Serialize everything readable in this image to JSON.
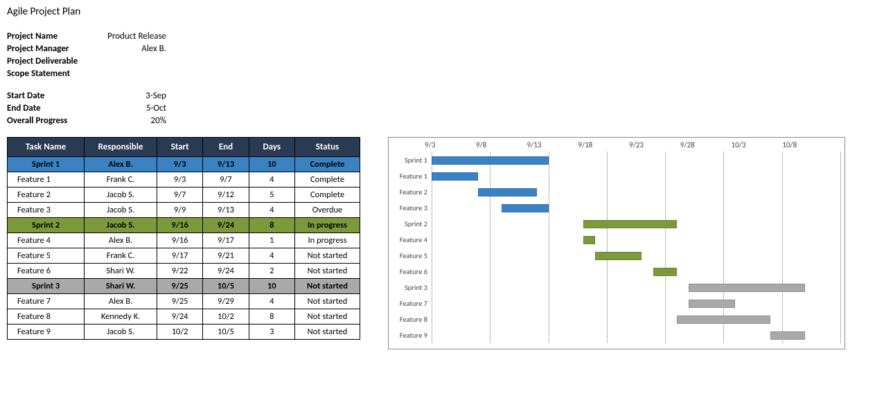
{
  "title": "Agile Project Plan",
  "info": {
    "project_name_label": "Project Name",
    "project_name_value": "Product Release",
    "project_manager_label": "Project Manager",
    "project_manager_value": "Alex B.",
    "deliverable_label": "Project Deliverable",
    "deliverable_value": "",
    "scope_label": "Scope Statement",
    "scope_value": "",
    "start_label": "Start Date",
    "start_value": "3-Sep",
    "end_label": "End Date",
    "end_value": "5-Oct",
    "progress_label": "Overall Progress",
    "progress_value": "20%"
  },
  "headers": {
    "task": "Task Name",
    "responsible": "Responsible",
    "start": "Start",
    "end": "End",
    "days": "Days",
    "status": "Status"
  },
  "rows": [
    {
      "task": "Sprint 1",
      "resp": "Alex B.",
      "start": "9/3",
      "end": "9/13",
      "days": "10",
      "status": "Complete",
      "kind": "sprint",
      "color": "blue"
    },
    {
      "task": "Feature 1",
      "resp": "Frank C.",
      "start": "9/3",
      "end": "9/7",
      "days": "4",
      "status": "Complete",
      "kind": "task",
      "color": "blue"
    },
    {
      "task": "Feature 2",
      "resp": "Jacob S.",
      "start": "9/7",
      "end": "9/12",
      "days": "5",
      "status": "Complete",
      "kind": "task",
      "color": "blue"
    },
    {
      "task": "Feature 3",
      "resp": "Jacob S.",
      "start": "9/9",
      "end": "9/13",
      "days": "4",
      "status": "Overdue",
      "kind": "task",
      "color": "blue"
    },
    {
      "task": "Sprint 2",
      "resp": "Jacob S.",
      "start": "9/16",
      "end": "9/24",
      "days": "8",
      "status": "In progress",
      "kind": "sprint",
      "color": "olive"
    },
    {
      "task": "Feature 4",
      "resp": "Alex B.",
      "start": "9/16",
      "end": "9/17",
      "days": "1",
      "status": "In progress",
      "kind": "task",
      "color": "olive"
    },
    {
      "task": "Feature 5",
      "resp": "Frank C.",
      "start": "9/17",
      "end": "9/21",
      "days": "4",
      "status": "Not started",
      "kind": "task",
      "color": "olive"
    },
    {
      "task": "Feature 6",
      "resp": "Shari W.",
      "start": "9/22",
      "end": "9/24",
      "days": "2",
      "status": "Not started",
      "kind": "task",
      "color": "olive"
    },
    {
      "task": "Sprint 3",
      "resp": "Shari W.",
      "start": "9/25",
      "end": "10/5",
      "days": "10",
      "status": "Not started",
      "kind": "sprint",
      "color": "grey"
    },
    {
      "task": "Feature 7",
      "resp": "Alex B.",
      "start": "9/25",
      "end": "9/29",
      "days": "4",
      "status": "Not started",
      "kind": "task",
      "color": "grey"
    },
    {
      "task": "Feature 8",
      "resp": "Kennedy K.",
      "start": "9/24",
      "end": "10/2",
      "days": "8",
      "status": "Not started",
      "kind": "task",
      "color": "grey"
    },
    {
      "task": "Feature 9",
      "resp": "Jacob S.",
      "start": "10/2",
      "end": "10/5",
      "days": "3",
      "status": "Not started",
      "kind": "task",
      "color": "grey"
    }
  ],
  "chart_data": {
    "type": "gantt",
    "x_axis": {
      "ticks": [
        "9/3",
        "9/8",
        "9/13",
        "9/18",
        "9/23",
        "9/28",
        "10/3",
        "10/8"
      ],
      "tick_numeric": [
        3,
        8,
        13,
        18,
        23,
        28,
        33,
        38
      ],
      "min": 3,
      "max": 38
    },
    "series": [
      {
        "name": "Sprint 1",
        "start": 3,
        "end": 13,
        "color": "blue"
      },
      {
        "name": "Feature 1",
        "start": 3,
        "end": 7,
        "color": "blue"
      },
      {
        "name": "Feature 2",
        "start": 7,
        "end": 12,
        "color": "blue"
      },
      {
        "name": "Feature 3",
        "start": 9,
        "end": 13,
        "color": "blue"
      },
      {
        "name": "Sprint 2",
        "start": 16,
        "end": 24,
        "color": "olive"
      },
      {
        "name": "Feature 4",
        "start": 16,
        "end": 17,
        "color": "olive"
      },
      {
        "name": "Feature 5",
        "start": 17,
        "end": 21,
        "color": "olive"
      },
      {
        "name": "Feature 6",
        "start": 22,
        "end": 24,
        "color": "olive"
      },
      {
        "name": "Sprint 3",
        "start": 25,
        "end": 35,
        "color": "grey"
      },
      {
        "name": "Feature 7",
        "start": 25,
        "end": 29,
        "color": "grey"
      },
      {
        "name": "Feature 8",
        "start": 24,
        "end": 32,
        "color": "grey"
      },
      {
        "name": "Feature 9",
        "start": 32,
        "end": 35,
        "color": "grey"
      }
    ]
  }
}
